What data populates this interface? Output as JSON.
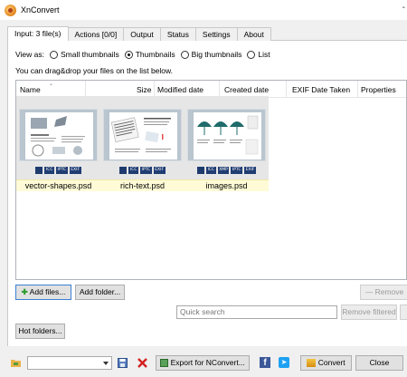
{
  "window": {
    "title": "XnConvert",
    "minimize_glyph": "-"
  },
  "tabs": [
    {
      "label": "Input: 3 file(s)",
      "active": true
    },
    {
      "label": "Actions [0/0]"
    },
    {
      "label": "Output"
    },
    {
      "label": "Status"
    },
    {
      "label": "Settings"
    },
    {
      "label": "About"
    }
  ],
  "view": {
    "label": "View as:",
    "options": [
      "Small thumbnails",
      "Thumbnails",
      "Big thumbnails",
      "List"
    ],
    "selected": "Thumbnails"
  },
  "hint": "You can drag&drop your files on the list below.",
  "columns": [
    "Name",
    "Size",
    "Modified date",
    "Created date",
    "EXIF Date Taken",
    "Properties"
  ],
  "files": [
    {
      "name": "vector-shapes.psd",
      "badges": [
        "ICC",
        "IPTC",
        "EXIF"
      ]
    },
    {
      "name": "rich-text.psd",
      "badges": [
        "ICC",
        "IPTC",
        "EXIF"
      ]
    },
    {
      "name": "images.psd",
      "badges": [
        "ICC",
        "XMP",
        "IPTC",
        "EXIF"
      ]
    }
  ],
  "buttons": {
    "add_files": "Add files...",
    "add_folder": "Add folder...",
    "remove": "Remove",
    "remove_filtered": "Remove filtered",
    "hot_folders": "Hot folders...",
    "export": "Export for NConvert...",
    "convert": "Convert",
    "close": "Close"
  },
  "search": {
    "placeholder": "Quick search"
  },
  "icons": {
    "app": "xnconvert-logo-icon",
    "save": "save-icon",
    "delete": "delete-red-x-icon",
    "export": "export-icon",
    "facebook": "facebook-icon",
    "twitter": "twitter-icon",
    "convert": "convert-icon",
    "folder": "folder-icon"
  },
  "colors": {
    "accent": "#3a80d4",
    "selection": "#fffbd6",
    "badge": "#203d73"
  }
}
